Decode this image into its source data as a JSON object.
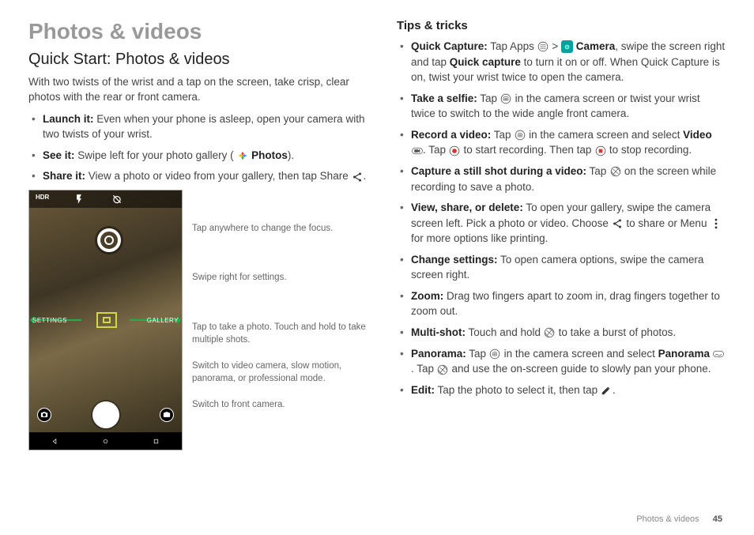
{
  "page_title": "Photos & videos",
  "section_title": "Quick Start: Photos & videos",
  "intro": "With two twists of the wrist and a tap on the screen, take crisp, clear photos with the rear or front camera.",
  "left_bullets": [
    {
      "label": "Launch it:",
      "text": " Even when your phone is asleep, open your camera with two twists of your wrist."
    },
    {
      "label": "See it:",
      "text_before": " Swipe left for your photo gallery ( ",
      "icon": "photos-icon",
      "text_after": " Photos).",
      "text_after_bold": "Photos"
    },
    {
      "label": "Share it:",
      "text_before": " View a photo or video from your gallery, then tap Share ",
      "icon": "share-icon",
      "text_after": "."
    }
  ],
  "phone_ui": {
    "top_icons": [
      "hdr-icon",
      "flash-icon",
      "timer-off-icon"
    ],
    "settings_label": "SETTINGS",
    "gallery_label": "GALLERY"
  },
  "annotations": [
    "Tap anywhere to change the focus.",
    "Swipe right for settings.",
    "Tap to take a photo. Touch and hold to take multiple shots.",
    "Switch to video camera, slow motion, panorama, or professional mode.",
    "Switch to front camera."
  ],
  "tips_title": "Tips & tricks",
  "tips": [
    {
      "label": "Quick Capture:",
      "parts": [
        {
          "t": " Tap Apps "
        },
        {
          "icon": "apps-icon"
        },
        {
          "t": " > "
        },
        {
          "icon": "camera-app-icon"
        },
        {
          "t": " "
        },
        {
          "b": "Camera"
        },
        {
          "t": ", swipe the screen right and tap "
        },
        {
          "b": "Quick capture"
        },
        {
          "t": " to turn it on or off. When Quick Capture is on, twist your wrist twice to open the camera."
        }
      ]
    },
    {
      "label": "Take a selfie:",
      "parts": [
        {
          "t": " Tap "
        },
        {
          "icon": "selfie-icon"
        },
        {
          "t": " in the camera screen or twist your wrist twice to switch to the wide angle front camera."
        }
      ]
    },
    {
      "label": "Record a video:",
      "parts": [
        {
          "t": " Tap "
        },
        {
          "icon": "mode-icon"
        },
        {
          "t": " in the camera screen and select "
        },
        {
          "b": "Video"
        },
        {
          "t": " "
        },
        {
          "icon": "video-icon"
        },
        {
          "t": ". Tap "
        },
        {
          "icon": "record-icon"
        },
        {
          "t": " to start recording. Then tap "
        },
        {
          "icon": "stop-icon"
        },
        {
          "t": " to stop recording."
        }
      ]
    },
    {
      "label": "Capture a still shot during a video:",
      "parts": [
        {
          "t": " Tap "
        },
        {
          "icon": "shutter-icon"
        },
        {
          "t": " on the screen while recording to save a photo."
        }
      ]
    },
    {
      "label": "View, share, or delete:",
      "parts": [
        {
          "t": " To open your gallery, swipe the camera screen left. Pick a photo or video. Choose "
        },
        {
          "icon": "share-icon"
        },
        {
          "t": " to share or Menu "
        },
        {
          "icon": "menu-icon"
        },
        {
          "t": " for more options like printing."
        }
      ]
    },
    {
      "label": "Change settings:",
      "parts": [
        {
          "t": " To open camera options, swipe the camera screen right."
        }
      ]
    },
    {
      "label": "Zoom:",
      "parts": [
        {
          "t": " Drag two fingers apart to zoom in, drag fingers together to zoom out."
        }
      ]
    },
    {
      "label": "Multi-shot:",
      "parts": [
        {
          "t": " Touch and hold "
        },
        {
          "icon": "shutter-icon"
        },
        {
          "t": " to take a burst of photos."
        }
      ]
    },
    {
      "label": "Panorama:",
      "parts": [
        {
          "t": " Tap "
        },
        {
          "icon": "mode-icon"
        },
        {
          "t": " in the camera screen and select "
        },
        {
          "b": "Panorama"
        },
        {
          "t": " "
        },
        {
          "icon": "panorama-icon"
        },
        {
          "t": ". Tap "
        },
        {
          "icon": "shutter-icon"
        },
        {
          "t": " and use the on-screen guide to slowly pan your phone."
        }
      ]
    },
    {
      "label": "Edit:",
      "parts": [
        {
          "t": " Tap the photo to select it, then tap "
        },
        {
          "icon": "edit-icon"
        },
        {
          "t": "."
        }
      ]
    }
  ],
  "footer_label": "Photos & videos",
  "page_number": "45"
}
